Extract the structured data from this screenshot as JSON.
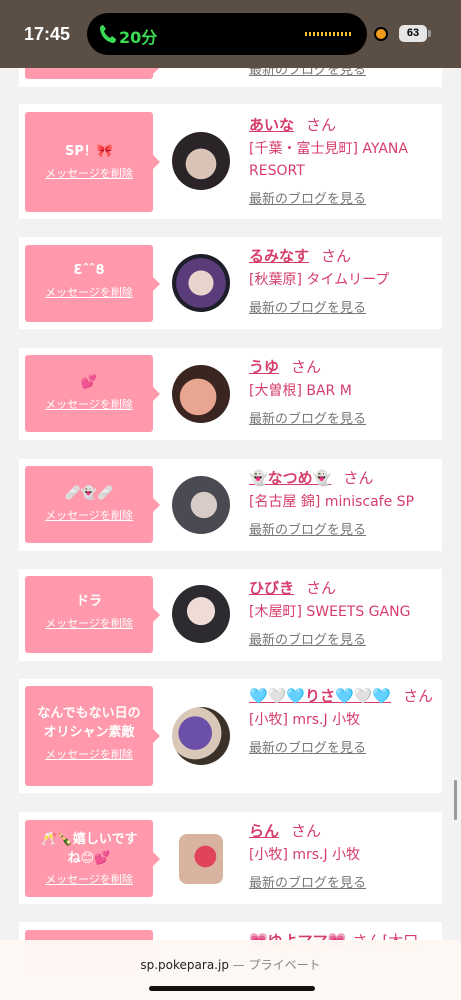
{
  "status_bar": {
    "time": "17:45",
    "call_duration": "20分",
    "battery": "63"
  },
  "top_partial_card": {
    "blog_link": "最新のブログを見る"
  },
  "messages": [
    {
      "message": "SP！🎀",
      "delete_label": "メッセージを削除",
      "name": "あいな",
      "honorific": "さん",
      "shop": "[千葉・富士見町] AYANA RESORT",
      "blog_link": "最新のブログを見る"
    },
    {
      "message": "ƐˆˆՑ",
      "delete_label": "メッセージを削除",
      "name": "るみなす",
      "honorific": "さん",
      "shop": "[秋葉原] タイムリープ",
      "blog_link": "最新のブログを見る"
    },
    {
      "message": "💕",
      "delete_label": "メッセージを削除",
      "name": "うゆ",
      "honorific": "さん",
      "shop": "[大曽根] BAR M",
      "blog_link": "最新のブログを見る"
    },
    {
      "message": "🩹👻🩹",
      "delete_label": "メッセージを削除",
      "name": "👻なつめ👻",
      "honorific": "さん",
      "shop": "[名古屋 錦] miniscafe SP",
      "blog_link": "最新のブログを見る"
    },
    {
      "message": "ドラ",
      "delete_label": "メッセージを削除",
      "name": "ひびき",
      "honorific": "さん",
      "shop": "[木屋町] SWEETS GANG",
      "blog_link": "最新のブログを見る"
    },
    {
      "message_line1": "なんでもない日の",
      "message_line2": "オリシャン素敵",
      "delete_label": "メッセージを削除",
      "name": "🩵🤍🩵りさ🩵🤍🩵",
      "honorific": "さん",
      "shop": "[小牧] mrs.J 小牧",
      "blog_link": "最新のブログを見る"
    },
    {
      "message_line1": "🥂🍾嬉しいです",
      "message_line2": "ね😊💕",
      "delete_label": "メッセージを削除",
      "name": "らん",
      "honorific": "さん",
      "shop": "[小牧] mrs.J 小牧",
      "blog_link": "最新のブログを見る"
    }
  ],
  "bottom_partial_card": {
    "name": "💗ゆよママ💗",
    "honorific": "さん",
    "shop_fragment": "[木口"
  },
  "address_bar": {
    "url": "sp.pokepara.jp",
    "separator": "—",
    "mode": "プライベート"
  },
  "colors": {
    "accent_pink": "#ff99ab",
    "name_pink": "#d63d6b",
    "status_bg": "#5b4f45"
  }
}
